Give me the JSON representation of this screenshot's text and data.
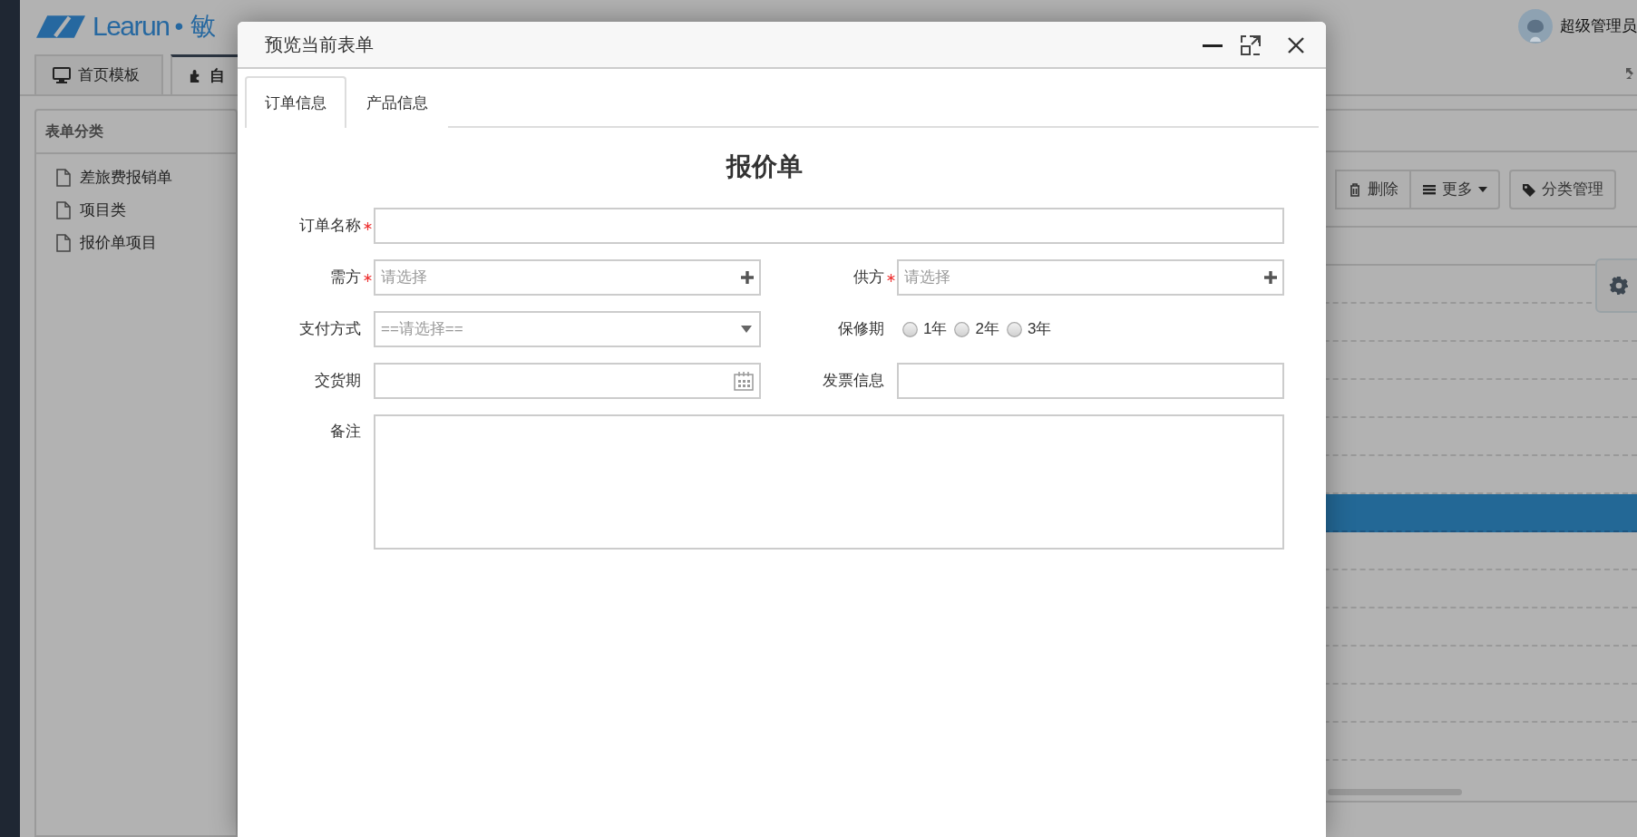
{
  "header": {
    "logo": "Learun",
    "subtitle": "• 敏",
    "user_name": "超级管理员"
  },
  "page_tabs": [
    {
      "label": "首页模板",
      "selected": false
    },
    {
      "label": "自",
      "selected": true
    }
  ],
  "sidebar": {
    "title": "表单分类",
    "items": [
      {
        "label": "差旅费报销单"
      },
      {
        "label": "项目类"
      },
      {
        "label": "报价单项目"
      }
    ]
  },
  "toolbar": {
    "buttons": [
      {
        "label": "删除",
        "dropdown": false
      },
      {
        "label": "更多",
        "dropdown": true
      },
      {
        "label": "分类管理",
        "dropdown": false
      }
    ]
  },
  "table": {
    "rows": [
      {
        "selected": false
      },
      {
        "selected": false
      },
      {
        "selected": false
      },
      {
        "selected": false
      },
      {
        "selected": false
      },
      {
        "selected": false
      },
      {
        "selected": true
      },
      {
        "selected": false
      },
      {
        "selected": false
      },
      {
        "selected": false
      },
      {
        "selected": false
      },
      {
        "selected": false
      },
      {
        "selected": false
      }
    ]
  },
  "modal": {
    "title": "预览当前表单",
    "tabs": [
      {
        "label": "订单信息",
        "selected": true
      },
      {
        "label": "产品信息",
        "selected": false
      }
    ],
    "form_title": "报价单",
    "rows": [
      [
        {
          "kind": "text",
          "label": "订单名称",
          "required": true
        }
      ],
      [
        {
          "kind": "picker",
          "label": "需方",
          "required": true,
          "placeholder": "请选择"
        },
        {
          "kind": "picker",
          "label": "供方",
          "required": true,
          "placeholder": "请选择"
        }
      ],
      [
        {
          "kind": "select",
          "label": "支付方式",
          "required": false,
          "value": "==请选择=="
        },
        {
          "kind": "radio",
          "label": "保修期",
          "required": false,
          "options": [
            {
              "label": "1年",
              "selected": false
            },
            {
              "label": "2年",
              "selected": false
            },
            {
              "label": "3年",
              "selected": false
            }
          ]
        }
      ],
      [
        {
          "kind": "date",
          "label": "交货期",
          "required": false
        },
        {
          "kind": "text",
          "label": "发票信息",
          "required": false
        }
      ],
      [
        {
          "kind": "textarea",
          "label": "备注",
          "required": false
        }
      ]
    ]
  }
}
